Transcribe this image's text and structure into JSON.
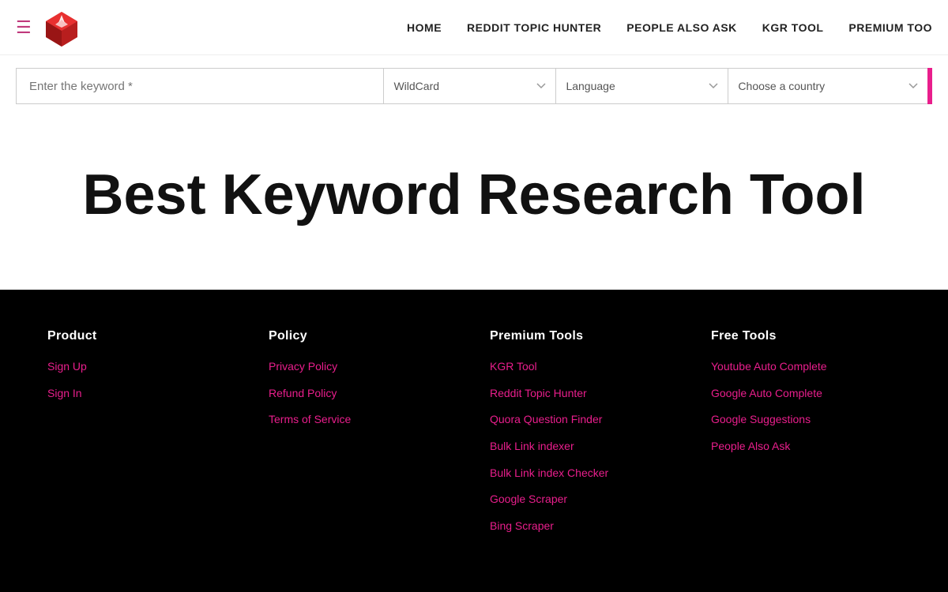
{
  "header": {
    "hamburger_label": "☰",
    "nav_links": [
      {
        "label": "HOME",
        "id": "home"
      },
      {
        "label": "REDDIT TOPIC HUNTER",
        "id": "reddit-topic-hunter"
      },
      {
        "label": "PEOPLE ALSO ASK",
        "id": "people-also-ask"
      },
      {
        "label": "KGR TOOL",
        "id": "kgr-tool"
      },
      {
        "label": "PREMIUM TOO",
        "id": "premium-tool"
      }
    ]
  },
  "search": {
    "keyword_placeholder": "Enter the keyword *",
    "wildcard_option": "WildCard",
    "language_option": "Language",
    "country_option": "Choose a country"
  },
  "hero": {
    "title": "Best Keyword Research Tool"
  },
  "footer": {
    "columns": [
      {
        "heading": "Product",
        "links": [
          {
            "label": "Sign Up"
          },
          {
            "label": "Sign In"
          }
        ]
      },
      {
        "heading": "Policy",
        "links": [
          {
            "label": "Privacy Policy"
          },
          {
            "label": "Refund Policy"
          },
          {
            "label": "Terms of Service"
          }
        ]
      },
      {
        "heading": "Premium Tools",
        "links": [
          {
            "label": "KGR Tool"
          },
          {
            "label": "Reddit Topic Hunter"
          },
          {
            "label": "Quora Question Finder"
          },
          {
            "label": "Bulk Link indexer"
          },
          {
            "label": "Bulk Link index Checker"
          },
          {
            "label": "Google Scraper"
          },
          {
            "label": "Bing Scraper"
          }
        ]
      },
      {
        "heading": "Free Tools",
        "links": [
          {
            "label": "Youtube Auto Complete"
          },
          {
            "label": "Google Auto Complete"
          },
          {
            "label": "Google Suggestions"
          },
          {
            "label": "People Also Ask"
          }
        ]
      }
    ]
  }
}
